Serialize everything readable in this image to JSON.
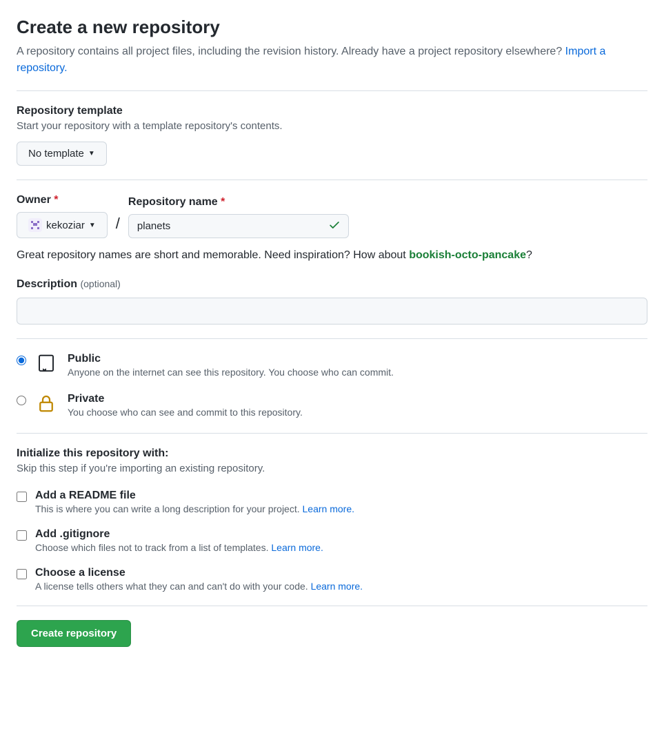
{
  "header": {
    "title": "Create a new repository",
    "subhead_pre": "A repository contains all project files, including the revision history. Already have a project repository elsewhere? ",
    "import_link": "Import a repository."
  },
  "template": {
    "label": "Repository template",
    "desc": "Start your repository with a template repository's contents.",
    "selected": "No template"
  },
  "owner": {
    "label": "Owner",
    "selected": "kekoziar"
  },
  "repo_name": {
    "label": "Repository name",
    "value": "planets"
  },
  "name_hint": {
    "pre": "Great repository names are short and memorable. Need inspiration? How about ",
    "suggestion": "bookish-octo-pancake",
    "post": "?"
  },
  "description": {
    "label": "Description",
    "optional": "(optional)",
    "value": ""
  },
  "visibility": {
    "public": {
      "title": "Public",
      "desc": "Anyone on the internet can see this repository. You choose who can commit."
    },
    "private": {
      "title": "Private",
      "desc": "You choose who can see and commit to this repository."
    },
    "selected": "public"
  },
  "init": {
    "heading": "Initialize this repository with:",
    "skip": "Skip this step if you're importing an existing repository.",
    "readme": {
      "title": "Add a README file",
      "desc": "This is where you can write a long description for your project. ",
      "link": "Learn more."
    },
    "gitignore": {
      "title": "Add .gitignore",
      "desc": "Choose which files not to track from a list of templates. ",
      "link": "Learn more."
    },
    "license": {
      "title": "Choose a license",
      "desc": "A license tells others what they can and can't do with your code. ",
      "link": "Learn more."
    }
  },
  "submit": "Create repository"
}
